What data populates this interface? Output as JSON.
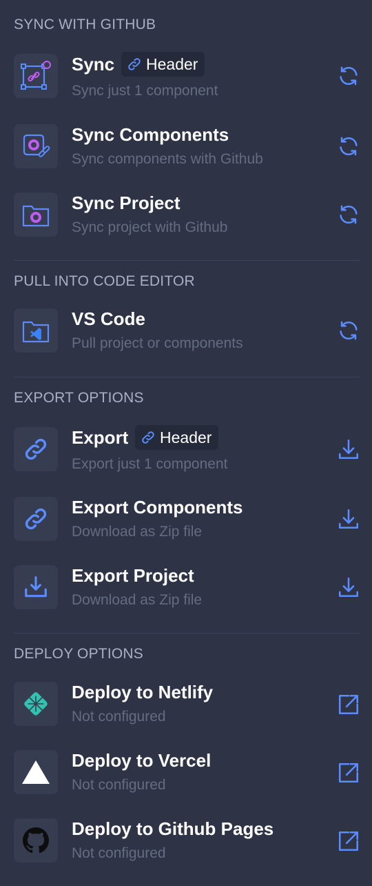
{
  "colors": {
    "background": "#2e3446",
    "tile": "#363d50",
    "accent": "#5b8cff",
    "subtext": "#646c80",
    "section": "#a8b0c4",
    "github_purple": "#c05cf0"
  },
  "sections": {
    "sync": {
      "title": "SYNC WITH GITHUB"
    },
    "pull": {
      "title": "PULL INTO CODE EDITOR"
    },
    "export": {
      "title": "EXPORT OPTIONS"
    },
    "deploy": {
      "title": "DEPLOY OPTIONS"
    }
  },
  "items": {
    "sync": {
      "title": "Sync",
      "chip": "Header",
      "subtitle": "Sync just 1 component",
      "icon": "component-link-github-icon",
      "action_icon": "sync-icon"
    },
    "sync_components": {
      "title": "Sync Components",
      "subtitle": "Sync components with Github",
      "icon": "github-components-icon",
      "action_icon": "sync-icon"
    },
    "sync_project": {
      "title": "Sync Project",
      "subtitle": "Sync project with Github",
      "icon": "github-folder-icon",
      "action_icon": "sync-icon"
    },
    "vscode": {
      "title": "VS Code",
      "subtitle": "Pull project or components",
      "icon": "vscode-folder-icon",
      "action_icon": "sync-icon"
    },
    "export": {
      "title": "Export",
      "chip": "Header",
      "subtitle": "Export just 1 component",
      "icon": "link-icon",
      "action_icon": "download-icon"
    },
    "export_components": {
      "title": "Export Components",
      "subtitle": "Download as Zip file",
      "icon": "link-icon",
      "action_icon": "download-icon"
    },
    "export_project": {
      "title": "Export Project",
      "subtitle": "Download as Zip file",
      "icon": "download-tray-icon",
      "action_icon": "download-icon"
    },
    "netlify": {
      "title": "Deploy to Netlify",
      "subtitle": "Not configured",
      "icon": "netlify-icon",
      "action_icon": "external-link-icon"
    },
    "vercel": {
      "title": "Deploy to Vercel",
      "subtitle": "Not configured",
      "icon": "vercel-icon",
      "action_icon": "external-link-icon"
    },
    "github_pages": {
      "title": "Deploy to Github Pages",
      "subtitle": "Not configured",
      "icon": "github-icon",
      "action_icon": "external-link-icon"
    }
  }
}
